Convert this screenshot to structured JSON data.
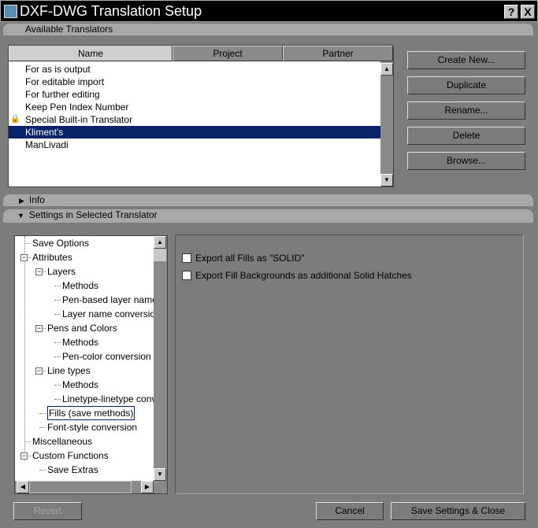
{
  "window": {
    "title": "DXF-DWG Translation Setup",
    "help": "?",
    "close": "X"
  },
  "available": {
    "header": "Available Translators",
    "columns": [
      "Name",
      "Project",
      "Partner"
    ],
    "items": [
      {
        "label": "For as is output",
        "locked": false,
        "selected": false
      },
      {
        "label": "For editable import",
        "locked": false,
        "selected": false
      },
      {
        "label": "For further editing",
        "locked": false,
        "selected": false
      },
      {
        "label": "Keep Pen Index Number",
        "locked": false,
        "selected": false
      },
      {
        "label": "Special Built-in Translator",
        "locked": true,
        "selected": false
      },
      {
        "label": "Kliment's",
        "locked": false,
        "selected": true
      },
      {
        "label": "ManLivadi",
        "locked": false,
        "selected": false
      }
    ],
    "buttons": [
      "Create New...",
      "Duplicate",
      "Rename...",
      "Delete",
      "Browse..."
    ]
  },
  "info": {
    "label": "Info",
    "expanded": false
  },
  "settings": {
    "label": "Settings in Selected Translator",
    "expanded": true,
    "tree": [
      {
        "label": "Save Options",
        "level": 0
      },
      {
        "label": "Attributes",
        "level": 0,
        "exp": true
      },
      {
        "label": "Layers",
        "level": 1,
        "exp": true
      },
      {
        "label": "Methods",
        "level": 2
      },
      {
        "label": "Pen-based layer name",
        "level": 2
      },
      {
        "label": "Layer name conversion",
        "level": 2
      },
      {
        "label": "Pens and Colors",
        "level": 1,
        "exp": true
      },
      {
        "label": "Methods",
        "level": 2
      },
      {
        "label": "Pen-color conversion",
        "level": 2
      },
      {
        "label": "Line types",
        "level": 1,
        "exp": true
      },
      {
        "label": "Methods",
        "level": 2
      },
      {
        "label": "Linetype-linetype conversion",
        "level": 2
      },
      {
        "label": "Fills (save methods)",
        "level": 1,
        "selected": true
      },
      {
        "label": "Font-style conversion",
        "level": 1
      },
      {
        "label": "Miscellaneous",
        "level": 0
      },
      {
        "label": "Custom Functions",
        "level": 0,
        "exp": true
      },
      {
        "label": "Save Extras",
        "level": 1
      }
    ],
    "options": [
      {
        "label": "Export all Fills as \"SOLID\"",
        "checked": false
      },
      {
        "label": "Export Fill Backgrounds as additional Solid Hatches",
        "checked": false
      }
    ]
  },
  "footer": {
    "revert": "Revert",
    "cancel": "Cancel",
    "save": "Save Settings & Close"
  }
}
